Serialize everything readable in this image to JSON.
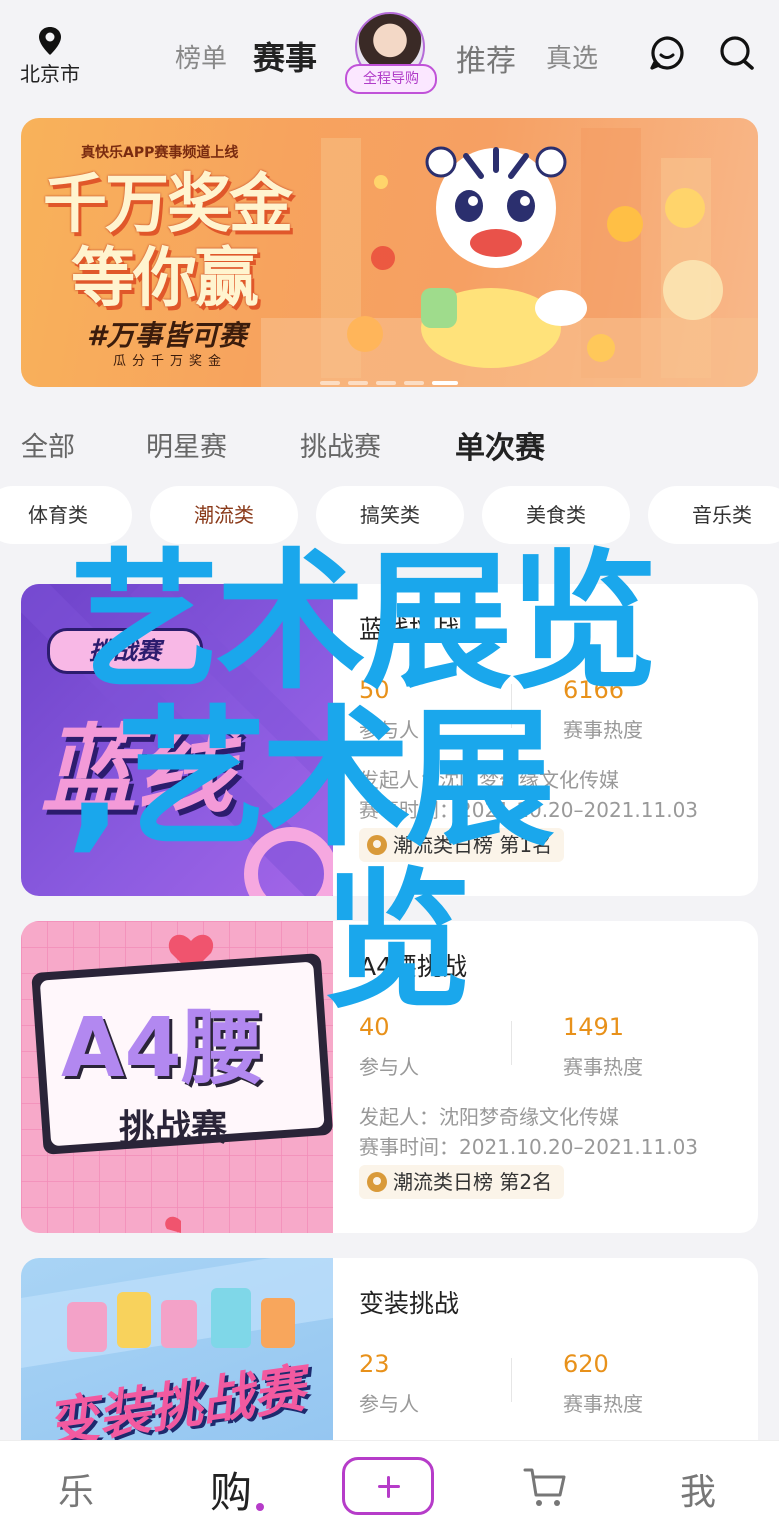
{
  "header": {
    "city": "北京市",
    "tabs": [
      "榜单",
      "赛事",
      "推荐",
      "真选"
    ],
    "active_tab": "赛事",
    "guide_label": "全程导购",
    "icons": [
      "location-pin-icon",
      "message-icon",
      "search-icon"
    ]
  },
  "banner": {
    "top_text": "真快乐APP赛事频道上线",
    "title_line1": "千万奖金",
    "title_line2": "等你赢",
    "slogan": "#万事皆可赛",
    "sub_slogan": "瓜分千万奖金",
    "slide_count": 5,
    "active_slide": 4
  },
  "category_tabs": {
    "items": [
      "全部",
      "明星赛",
      "挑战赛",
      "单次赛"
    ],
    "active": "单次赛"
  },
  "chips": {
    "items": [
      "体育类",
      "潮流类",
      "搞笑类",
      "美食类",
      "音乐类"
    ],
    "active": "潮流类"
  },
  "cards": [
    {
      "title": "蓝线挑战",
      "participants": "50",
      "participants_label": "参与人",
      "heat": "6166",
      "heat_label": "赛事热度",
      "organizer": "发起人：沈阳梦奇缘文化传媒",
      "time": "赛事时间：2021.10.20–2021.11.03",
      "rank": "潮流类日榜  第1名",
      "image_tag": "挑战赛",
      "image_text": "蓝线"
    },
    {
      "title": "A4腰挑战",
      "participants": "40",
      "participants_label": "参与人",
      "heat": "1491",
      "heat_label": "赛事热度",
      "organizer": "发起人：沈阳梦奇缘文化传媒",
      "time": "赛事时间：2021.10.20–2021.11.03",
      "rank": "潮流类日榜  第2名",
      "image_text": "A4腰",
      "image_sub": "挑战赛"
    },
    {
      "title": "变装挑战",
      "participants": "23",
      "participants_label": "参与人",
      "heat": "620",
      "heat_label": "赛事热度",
      "image_text": "变装挑战赛"
    }
  ],
  "watermark": {
    "line1": "艺术展览",
    "line2": ",艺术展",
    "line3": "览",
    "color": "#1aa7ec"
  },
  "bottom_nav": {
    "items": [
      "乐",
      "购",
      "我"
    ],
    "active": "购",
    "plus_icon": "plus-icon",
    "cart_icon": "cart-icon"
  },
  "colors": {
    "accent": "#b63cc9",
    "stat": "#e8911a",
    "watermark": "#1aa7ec"
  }
}
